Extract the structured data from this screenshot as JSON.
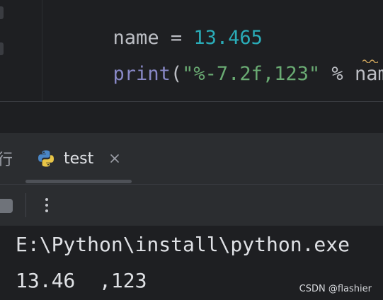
{
  "editor": {
    "lines": [
      {
        "tokens": [
          {
            "text": "name",
            "kind": "ident"
          },
          {
            "text": " = ",
            "kind": "punc"
          },
          {
            "text": "13.465",
            "kind": "num"
          }
        ]
      },
      {
        "tokens": [
          {
            "text": "print",
            "kind": "builtin"
          },
          {
            "text": "(",
            "kind": "punc"
          },
          {
            "text": "\"%-7.2f,123\"",
            "kind": "str"
          },
          {
            "text": " % ",
            "kind": "punc"
          },
          {
            "text": "name",
            "kind": "ident"
          },
          {
            "text": ")",
            "kind": "punc"
          }
        ]
      }
    ],
    "colors": {
      "background": "#1e1f22",
      "identifier": "#bcbec4",
      "number": "#2aacb8",
      "builtin": "#8888c6",
      "string": "#6aab73",
      "warning_squiggle": "#c9a15a"
    }
  },
  "run_panel": {
    "edge_tab_glyph": "行",
    "tab": {
      "icon": "python-icon",
      "label": "test",
      "close_icon": "close-icon"
    },
    "toolbar": {
      "stop_icon": "stop-icon",
      "more_icon": "more-vertical-icon"
    },
    "console": {
      "lines": [
        "E:\\Python\\install\\python.exe",
        "13.46  ,123"
      ]
    },
    "colors": {
      "panel_background": "#2b2d30",
      "console_text": "#dfe1e5"
    }
  },
  "watermark": "CSDN @flashier"
}
